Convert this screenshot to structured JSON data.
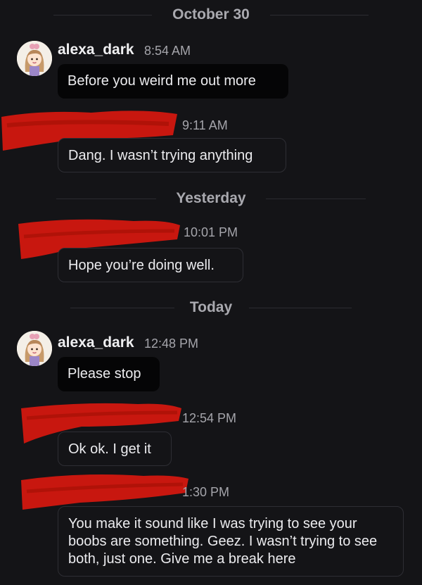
{
  "dividers": {
    "october": "October 30",
    "yesterday": "Yesterday",
    "today": "Today"
  },
  "messages": [
    {
      "sender": "alexa_dark",
      "time": "8:54 AM",
      "text": "Before you weird me out more"
    },
    {
      "sender": "",
      "time": "9:11 AM",
      "text": "Dang. I wasn’t trying anything"
    },
    {
      "sender": "",
      "time": "10:01 PM",
      "text": "Hope you’re doing well."
    },
    {
      "sender": "alexa_dark",
      "time": "12:48 PM",
      "text": "Please stop"
    },
    {
      "sender": "",
      "time": "12:54 PM",
      "text": "Ok ok. I get it"
    },
    {
      "sender": "",
      "time": "1:30 PM",
      "text": "You make it sound like I was trying to see your boobs are something. Geez. I wasn’t trying to see both, just one. Give me a break here"
    }
  ],
  "colors": {
    "background": "#141417",
    "incoming_bubble": "#050506",
    "outgoing_bubble_border": "#2e2e34",
    "redaction": "#c8170f"
  },
  "icons": {
    "avatar": "cartoon-girl-avatar-icon"
  }
}
